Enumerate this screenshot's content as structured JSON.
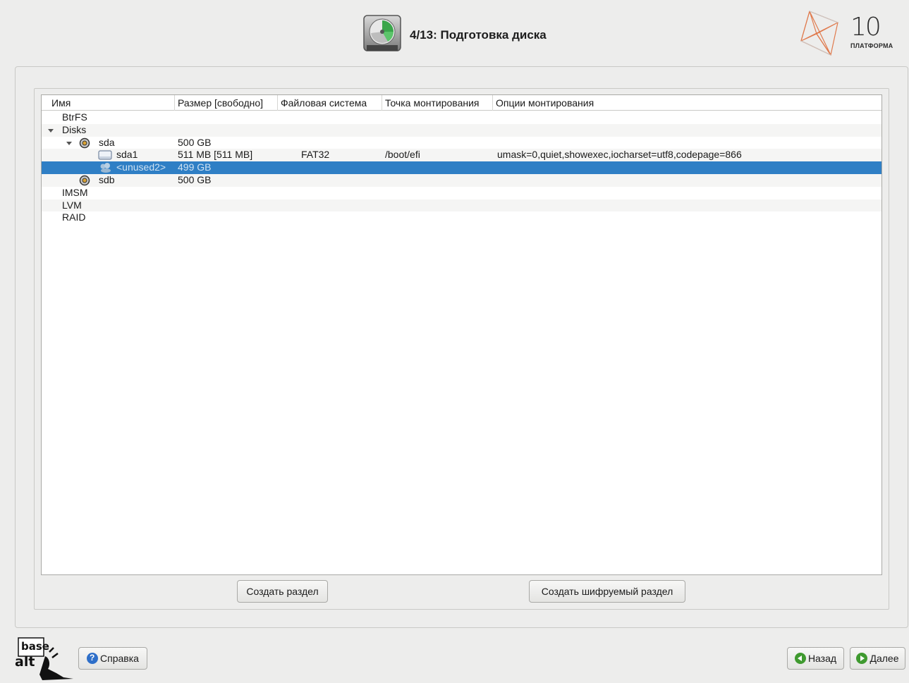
{
  "header": {
    "title": "4/13: Подготовка диска",
    "brand_number": "10",
    "brand_word": "ПЛАТФОРМА"
  },
  "tree": {
    "columns": [
      "Имя",
      "Размер [свободно]",
      "Файловая система",
      "Точка монтирования",
      "Опции монтирования"
    ],
    "rows": [
      {
        "name": "BtrFS",
        "size": "",
        "fs": "",
        "mount": "",
        "options": ""
      },
      {
        "name": "Disks",
        "size": "",
        "fs": "",
        "mount": "",
        "options": ""
      },
      {
        "name": "sda",
        "size": "500 GB",
        "fs": "",
        "mount": "",
        "options": ""
      },
      {
        "name": "sda1",
        "size": "511 MB [511 MB]",
        "fs": "FAT32",
        "mount": "/boot/efi",
        "options": "umask=0,quiet,showexec,iocharset=utf8,codepage=866"
      },
      {
        "name": "<unused2>",
        "size": "499 GB",
        "fs": "",
        "mount": "",
        "options": ""
      },
      {
        "name": "sdb",
        "size": "500 GB",
        "fs": "",
        "mount": "",
        "options": ""
      },
      {
        "name": "IMSM",
        "size": "",
        "fs": "",
        "mount": "",
        "options": ""
      },
      {
        "name": "LVM",
        "size": "",
        "fs": "",
        "mount": "",
        "options": ""
      },
      {
        "name": "RAID",
        "size": "",
        "fs": "",
        "mount": "",
        "options": ""
      }
    ],
    "selected_row": "<unused2>"
  },
  "actions": {
    "create_partition": "Создать раздел",
    "create_encrypted": "Создать шифруемый раздел"
  },
  "footer": {
    "logo_top": "base",
    "logo_bottom": "alt",
    "help": "Справка",
    "back": "Назад",
    "next": "Далее"
  },
  "colors": {
    "selection": "#2f7fc5",
    "window_bg": "#ededec",
    "help_icon": "#2e6fc9",
    "nav_icon": "#3f9a2f"
  }
}
